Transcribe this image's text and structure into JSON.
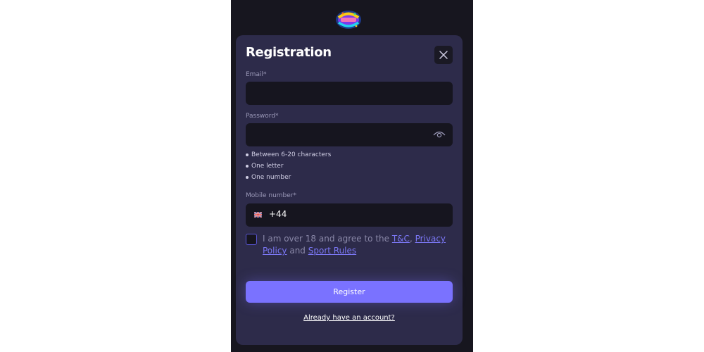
{
  "brand": {
    "logo_icon": "funky-jackpot-logo"
  },
  "modal": {
    "title": "Registration",
    "close_icon": "close-icon"
  },
  "form": {
    "email_label": "Email*",
    "email_value": "",
    "password_label": "Password*",
    "password_value": "",
    "password_toggle_icon": "eye-icon",
    "password_rules": [
      "Between 6-20 characters",
      "One letter",
      "One number"
    ],
    "mobile_label": "Mobile number*",
    "mobile_flag_icon": "uk-flag-icon",
    "mobile_prefix": "+44",
    "mobile_value": "",
    "agree_checked": false,
    "agree_text_1": "I am over 18 and agree to the ",
    "tc_link": "T&C",
    "agree_sep": ", ",
    "privacy_link": "Privacy Policy",
    "agree_and": " and ",
    "sport_rules_link": "Sport Rules",
    "register_label": "Register",
    "login_link": "Already have an account?"
  },
  "colors": {
    "page_bg": "#17161f",
    "modal_bg": "#2d2b4a",
    "input_bg": "#16151f",
    "accent": "#7a72ff",
    "link": "#7b77f5"
  }
}
